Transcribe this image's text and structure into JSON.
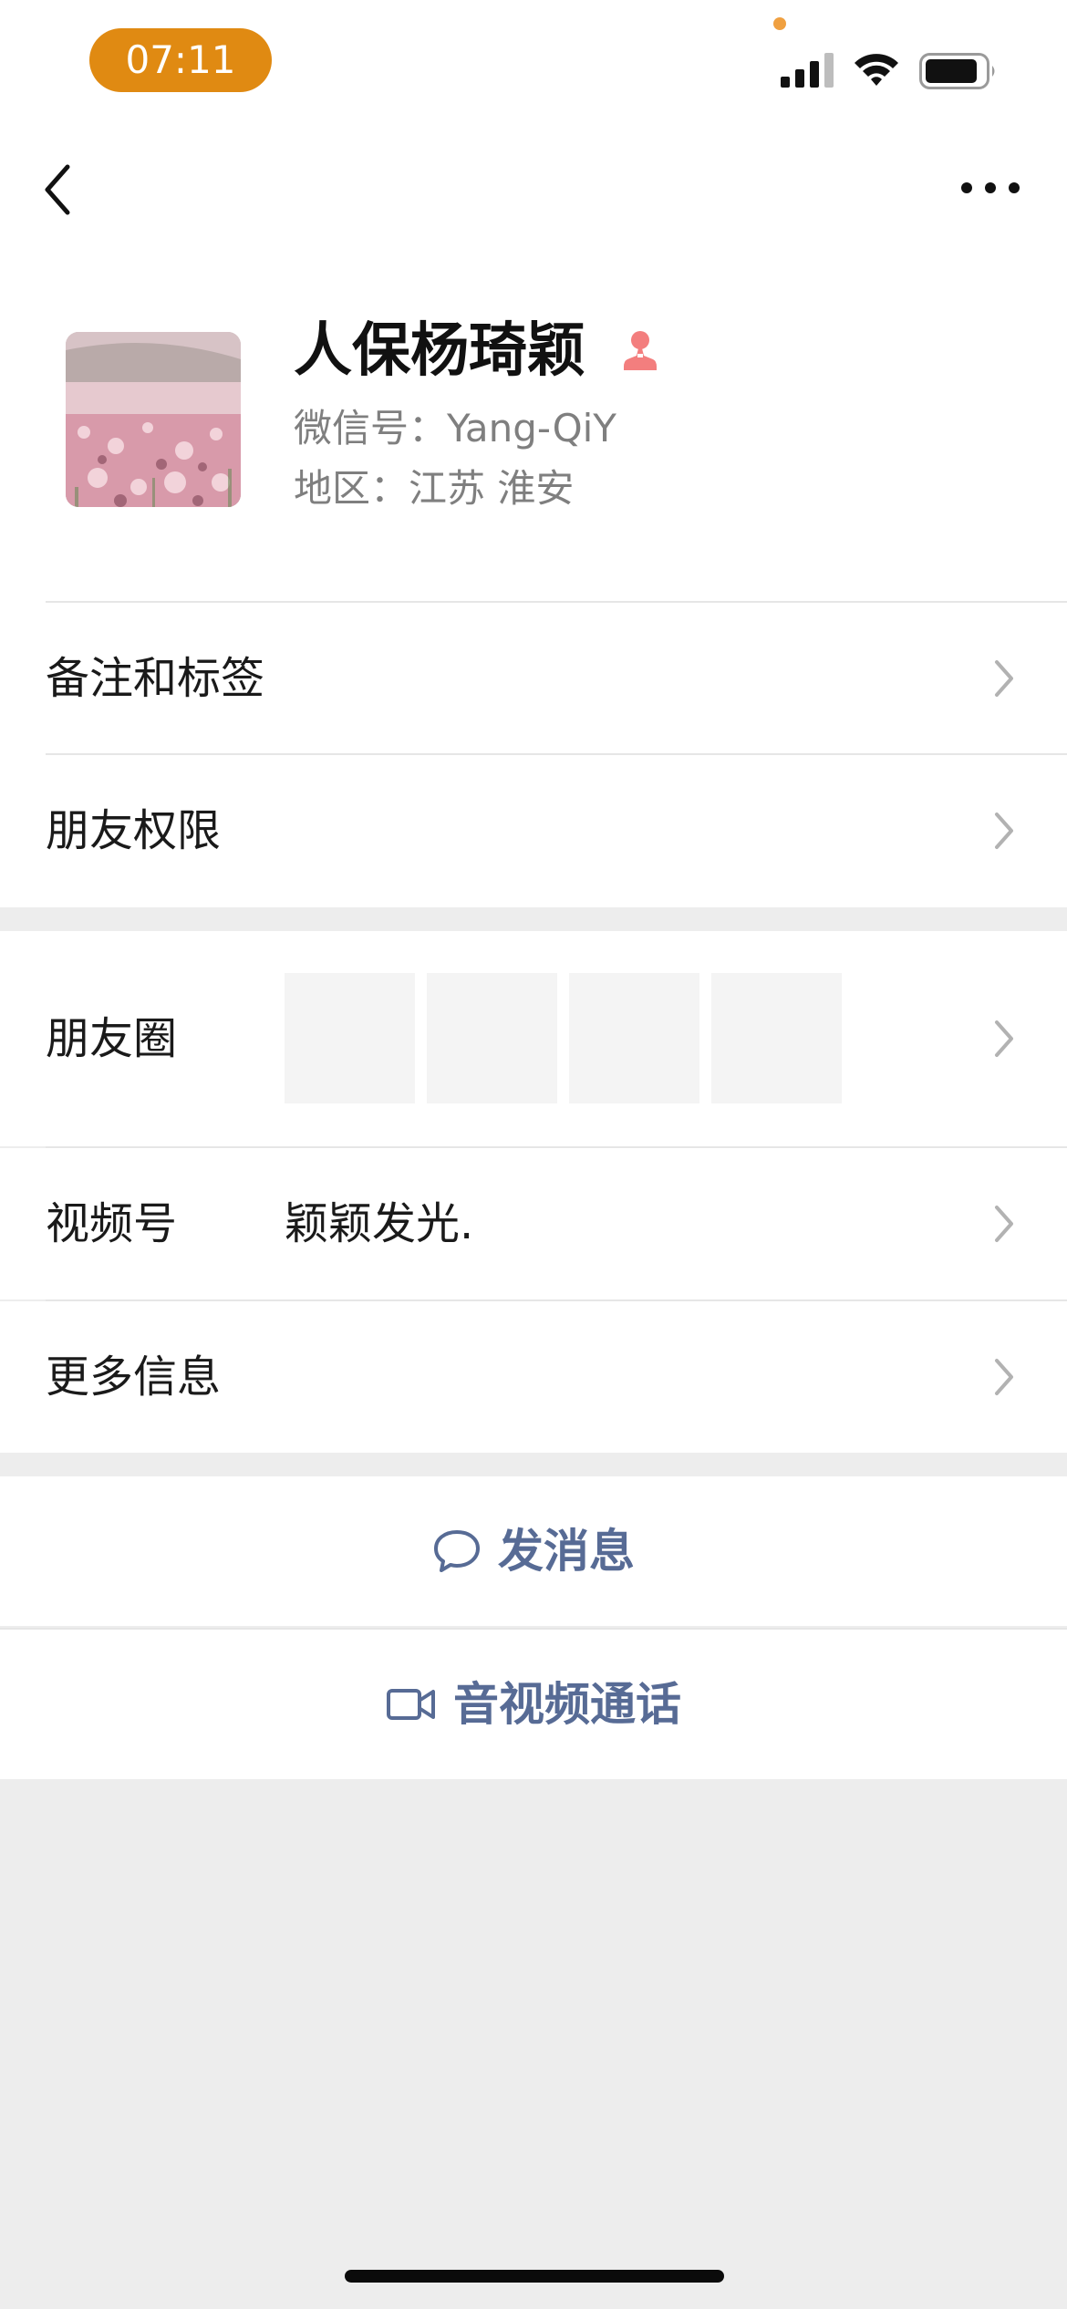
{
  "status_bar": {
    "time": "07:11",
    "pill_color": "#e08a12",
    "icons": [
      "signal-icon",
      "wifi-icon",
      "battery-icon"
    ]
  },
  "nav": {
    "back_icon": "chevron-left-icon",
    "more_icon": "more-dots-icon"
  },
  "profile": {
    "display_name": "人保杨琦颖",
    "gender_icon": "female-icon",
    "gender_color": "#f37e7e",
    "wechat_id": "微信号：Yang-QiY",
    "region": "地区：江苏 淮安"
  },
  "rows": {
    "remark_tags": "备注和标签",
    "friend_permissions": "朋友权限",
    "moments": "朋友圈",
    "channels": "视频号",
    "channels_value": "颖颖发光.",
    "more_info": "更多信息"
  },
  "actions": {
    "send_message": "发消息",
    "send_message_icon": "chat-bubble-icon",
    "av_call": "音视频通话",
    "av_call_icon": "video-camera-icon",
    "accent_color": "#576b95"
  }
}
